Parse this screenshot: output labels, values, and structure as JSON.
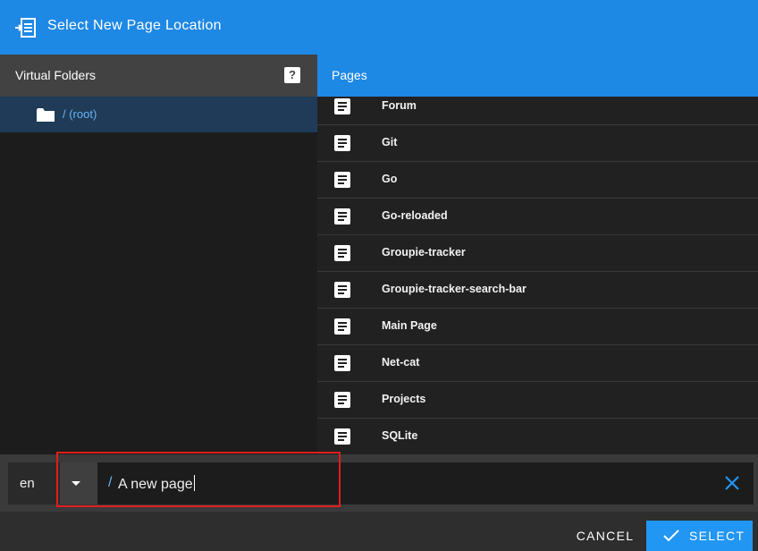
{
  "dialog": {
    "title": "Select New Page Location",
    "title_icon": "move-page-icon"
  },
  "folders": {
    "header": "Virtual Folders",
    "help_icon_text": "?",
    "items": [
      {
        "label": "/ (root)",
        "icon": "folder-icon",
        "selected": true
      }
    ]
  },
  "pages": {
    "header": "Pages",
    "items": [
      {
        "label": "Forum",
        "icon": "page-icon"
      },
      {
        "label": "Git",
        "icon": "page-icon"
      },
      {
        "label": "Go",
        "icon": "page-icon"
      },
      {
        "label": "Go-reloaded",
        "icon": "page-icon"
      },
      {
        "label": "Groupie-tracker",
        "icon": "page-icon"
      },
      {
        "label": "Groupie-tracker-search-bar",
        "icon": "page-icon"
      },
      {
        "label": "Main Page",
        "icon": "page-icon"
      },
      {
        "label": "Net-cat",
        "icon": "page-icon"
      },
      {
        "label": "Projects",
        "icon": "page-icon"
      },
      {
        "label": "SQLite",
        "icon": "page-icon"
      }
    ]
  },
  "path": {
    "locale": "en",
    "prefix": "/",
    "value": "A new page"
  },
  "actions": {
    "cancel": "CANCEL",
    "select": "SELECT"
  },
  "colors": {
    "primary": "#1e88e5",
    "accent_text": "#64b5f6",
    "highlight_border": "#e11d1d"
  }
}
